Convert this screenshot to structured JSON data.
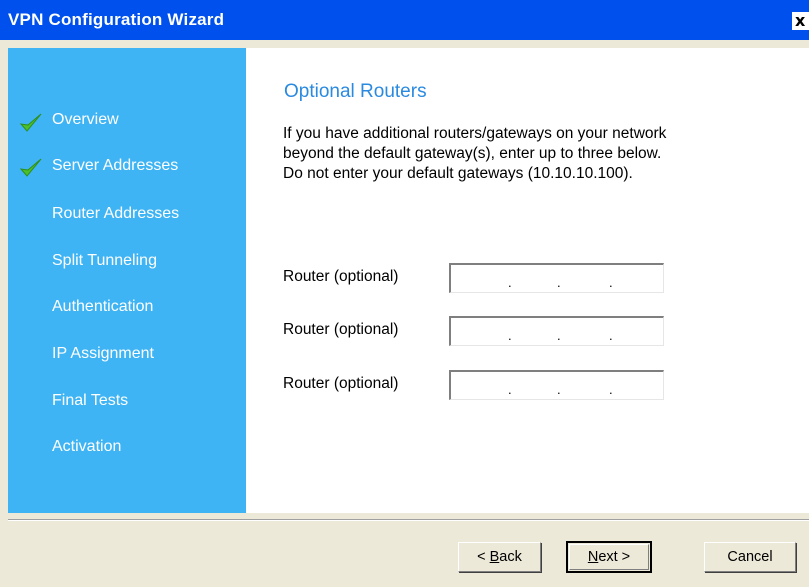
{
  "window": {
    "title": "VPN Configuration Wizard",
    "close_glyph": "x"
  },
  "sidebar": {
    "items": [
      {
        "label": "Overview",
        "completed": true,
        "icon": "checkmark-icon"
      },
      {
        "label": "Server Addresses",
        "completed": true,
        "icon": "checkmark-icon"
      },
      {
        "label": "Router Addresses",
        "completed": false
      },
      {
        "label": "Split Tunneling",
        "completed": false
      },
      {
        "label": "Authentication",
        "completed": false
      },
      {
        "label": "IP Assignment",
        "completed": false
      },
      {
        "label": "Final Tests",
        "completed": false
      },
      {
        "label": "Activation",
        "completed": false
      }
    ]
  },
  "main": {
    "heading": "Optional Routers",
    "description_lines": [
      "If you have additional routers/gateways on your network",
      "beyond the default gateway(s), enter up to three below.",
      "Do not enter your default gateways (10.10.10.100)."
    ],
    "routers": [
      {
        "label": "Router (optional)",
        "value": "   .   .   ."
      },
      {
        "label": "Router (optional)",
        "value": "   .   .   ."
      },
      {
        "label": "Router (optional)",
        "value": "   .   .   ."
      }
    ]
  },
  "buttons": {
    "back": {
      "prefix": "< ",
      "mnemonic": "B",
      "rest": "ack"
    },
    "next": {
      "mnemonic": "N",
      "rest": "ext >"
    },
    "cancel": "Cancel"
  },
  "colors": {
    "titlebar": "#0050ee",
    "sidebar": "#3eb4f4",
    "heading": "#2a8ae0",
    "dialog_face": "#ece9d8",
    "check": "#4cbf2a"
  }
}
